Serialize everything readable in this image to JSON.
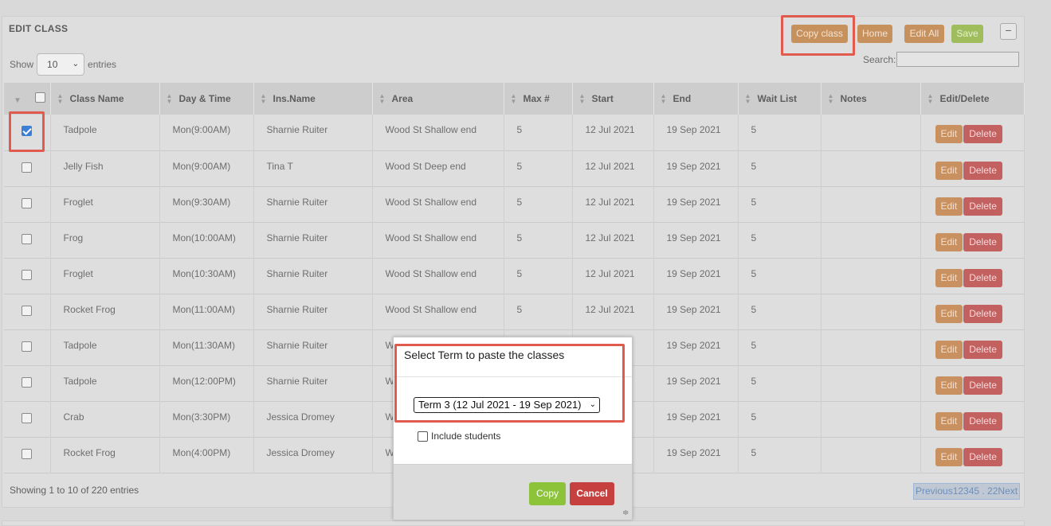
{
  "header": {
    "title": "EDIT CLASS",
    "copy_class": "Copy class",
    "home": "Home",
    "edit_all": "Edit All",
    "save": "Save",
    "collapse": "−"
  },
  "controls": {
    "show_label": "Show",
    "entries_value": "10",
    "entries_label": "entries",
    "search_label": "Search:",
    "search_value": ""
  },
  "table": {
    "columns": [
      "Class Name",
      "Day & Time",
      "Ins.Name",
      "Area",
      "Max #",
      "Start",
      "End",
      "Wait List",
      "Notes",
      "Edit/Delete"
    ],
    "edit_label": "Edit",
    "delete_label": "Delete",
    "rows": [
      {
        "checked": true,
        "name": "Tadpole",
        "time": "Mon(9:00AM)",
        "ins": "Sharnie Ruiter",
        "area": "Wood St Shallow end",
        "max": "5",
        "start": "12 Jul 2021",
        "end": "19 Sep 2021",
        "wait": "5",
        "notes": ""
      },
      {
        "checked": false,
        "name": "Jelly Fish",
        "time": "Mon(9:00AM)",
        "ins": "Tina T",
        "area": "Wood St Deep end",
        "max": "5",
        "start": "12 Jul 2021",
        "end": "19 Sep 2021",
        "wait": "5",
        "notes": ""
      },
      {
        "checked": false,
        "name": "Froglet",
        "time": "Mon(9:30AM)",
        "ins": "Sharnie Ruiter",
        "area": "Wood St Shallow end",
        "max": "5",
        "start": "12 Jul 2021",
        "end": "19 Sep 2021",
        "wait": "5",
        "notes": ""
      },
      {
        "checked": false,
        "name": "Frog",
        "time": "Mon(10:00AM)",
        "ins": "Sharnie Ruiter",
        "area": "Wood St Shallow end",
        "max": "5",
        "start": "12 Jul 2021",
        "end": "19 Sep 2021",
        "wait": "5",
        "notes": ""
      },
      {
        "checked": false,
        "name": "Froglet",
        "time": "Mon(10:30AM)",
        "ins": "Sharnie Ruiter",
        "area": "Wood St Shallow end",
        "max": "5",
        "start": "12 Jul 2021",
        "end": "19 Sep 2021",
        "wait": "5",
        "notes": ""
      },
      {
        "checked": false,
        "name": "Rocket Frog",
        "time": "Mon(11:00AM)",
        "ins": "Sharnie Ruiter",
        "area": "Wood St Shallow end",
        "max": "5",
        "start": "12 Jul 2021",
        "end": "19 Sep 2021",
        "wait": "5",
        "notes": ""
      },
      {
        "checked": false,
        "name": "Tadpole",
        "time": "Mon(11:30AM)",
        "ins": "Sharnie Ruiter",
        "area": "W",
        "max": "",
        "start": "",
        "end": "19 Sep 2021",
        "wait": "5",
        "notes": ""
      },
      {
        "checked": false,
        "name": "Tadpole",
        "time": "Mon(12:00PM)",
        "ins": "Sharnie Ruiter",
        "area": "W",
        "max": "",
        "start": "",
        "end": "19 Sep 2021",
        "wait": "5",
        "notes": ""
      },
      {
        "checked": false,
        "name": "Crab",
        "time": "Mon(3:30PM)",
        "ins": "Jessica Dromey",
        "area": "W",
        "max": "",
        "start": "",
        "end": "19 Sep 2021",
        "wait": "5",
        "notes": ""
      },
      {
        "checked": false,
        "name": "Rocket Frog",
        "time": "Mon(4:00PM)",
        "ins": "Jessica Dromey",
        "area": "W",
        "max": "",
        "start": "",
        "end": "19 Sep 2021",
        "wait": "5",
        "notes": ""
      }
    ]
  },
  "footer": {
    "info": "Showing 1 to 10 of 220 entries",
    "pager": "Previous12345 . 22Next"
  },
  "modal": {
    "title": "Select Term to paste the classes",
    "term_value": "Term 3 (12 Jul 2021 - 19 Sep 2021)",
    "include_students": "Include students",
    "copy": "Copy",
    "cancel": "Cancel"
  },
  "colors": {
    "highlight": "#e05a4e",
    "btn_orange": "#c7915e",
    "btn_green": "#9fbd5c",
    "btn_delete": "#c36060",
    "copy_green": "#8cc33b",
    "cancel_red": "#c6403f"
  }
}
